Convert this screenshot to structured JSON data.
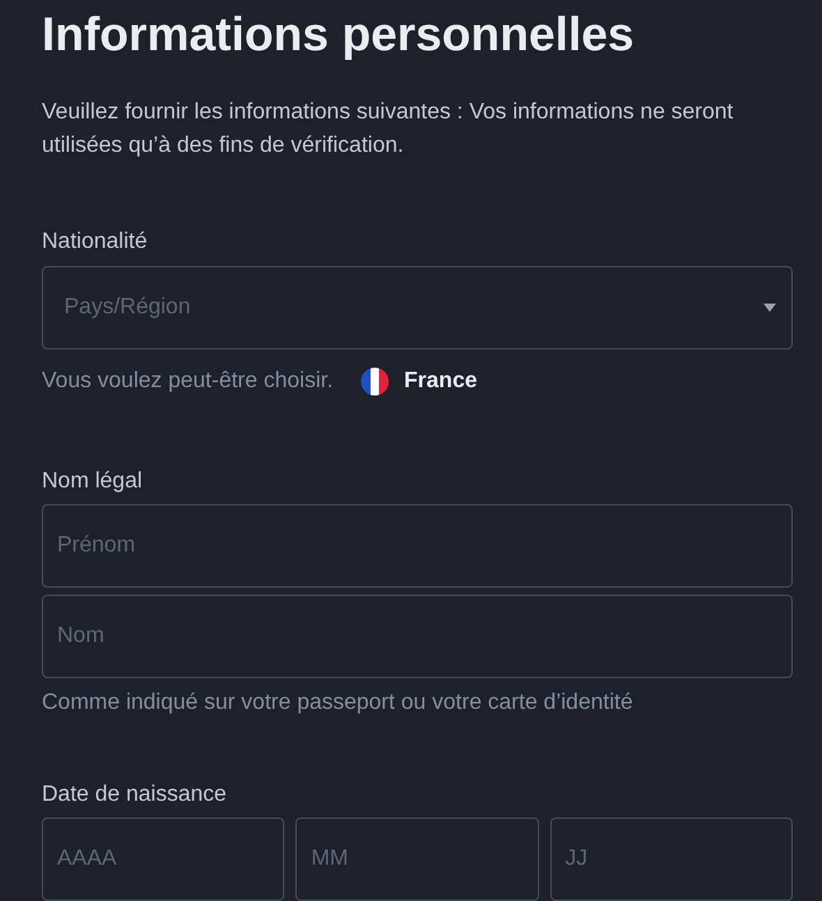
{
  "title": "Informations personnelles",
  "description": "Veuillez fournir les informations suivantes : Vos informations ne seront utilisées qu’à des fins de vérification.",
  "nationality": {
    "label": "Nationalité",
    "select": {
      "placeholder": "Pays/Région"
    },
    "suggestion": {
      "text": "Vous voulez peut-être choisir.",
      "country": "France"
    }
  },
  "legal_name": {
    "label": "Nom légal",
    "fields": [
      {
        "placeholder": "Prénom"
      },
      {
        "placeholder": "Nom"
      }
    ],
    "hint": "Comme indiqué sur votre passeport ou votre carte d’identité"
  },
  "birth_date": {
    "label": "Date de naissance",
    "fields": [
      {
        "placeholder": "AAAA"
      },
      {
        "placeholder": "MM"
      },
      {
        "placeholder": "JJ"
      }
    ]
  }
}
